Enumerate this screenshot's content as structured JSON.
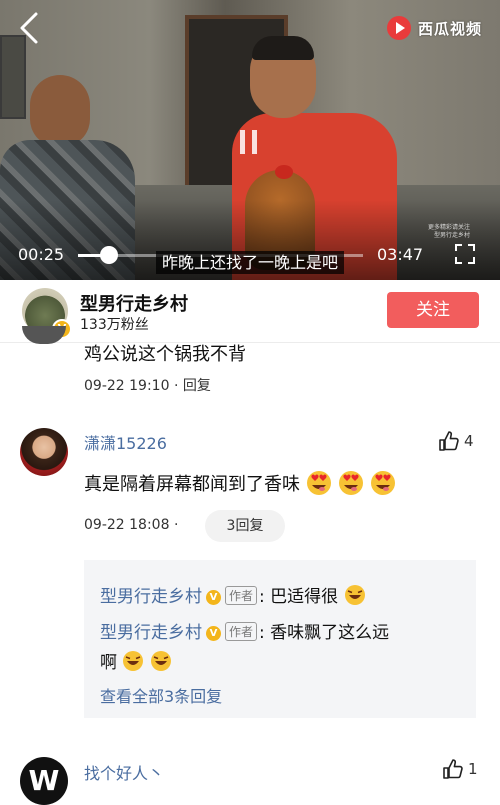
{
  "video": {
    "brand_name": "西瓜视频",
    "current_time": "00:25",
    "total_time": "03:47",
    "subtitle": "昨晚上还找了一晚上是吧",
    "progress": 0.11,
    "watermark_lines": [
      "更多精彩请关注",
      "型男行走乡村"
    ]
  },
  "header": {
    "author_name": "型男行走乡村",
    "fans": "133万粉丝",
    "follow_label": "关注",
    "verified_badge": "V"
  },
  "comments": [
    {
      "text": "鸡公说这个锅我不背",
      "time": "09-22 19:10",
      "separator": "·",
      "reply_label": "回复"
    },
    {
      "name": "潇潇15226",
      "likes": "4",
      "text": "真是隔着屏幕都闻到了香味",
      "emoji_count": 3,
      "time": "09-22 18:08",
      "separator": "·",
      "reply_count_label": "3回复",
      "replies": [
        {
          "name": "型男行走乡村",
          "tag": "作者",
          "text": ": 巴适得很"
        },
        {
          "name": "型男行走乡村",
          "tag": "作者",
          "text": ": 香味飘了这么远",
          "text_cont": "啊"
        }
      ],
      "view_all_label": "查看全部3条回复"
    },
    {
      "avatar_letter": "W",
      "name": "找个好人丶",
      "likes": "1"
    }
  ],
  "colors": {
    "accent_red": "#f25d5d",
    "link_blue": "#4a6da0",
    "badge_gold": "#f3b51b"
  },
  "icons": [
    "back-arrow-icon",
    "xigua-logo-icon",
    "pause-icon",
    "fullscreen-icon",
    "thumbs-up-icon",
    "grinning-heart-eyes-emoji",
    "grinning-emoji"
  ]
}
